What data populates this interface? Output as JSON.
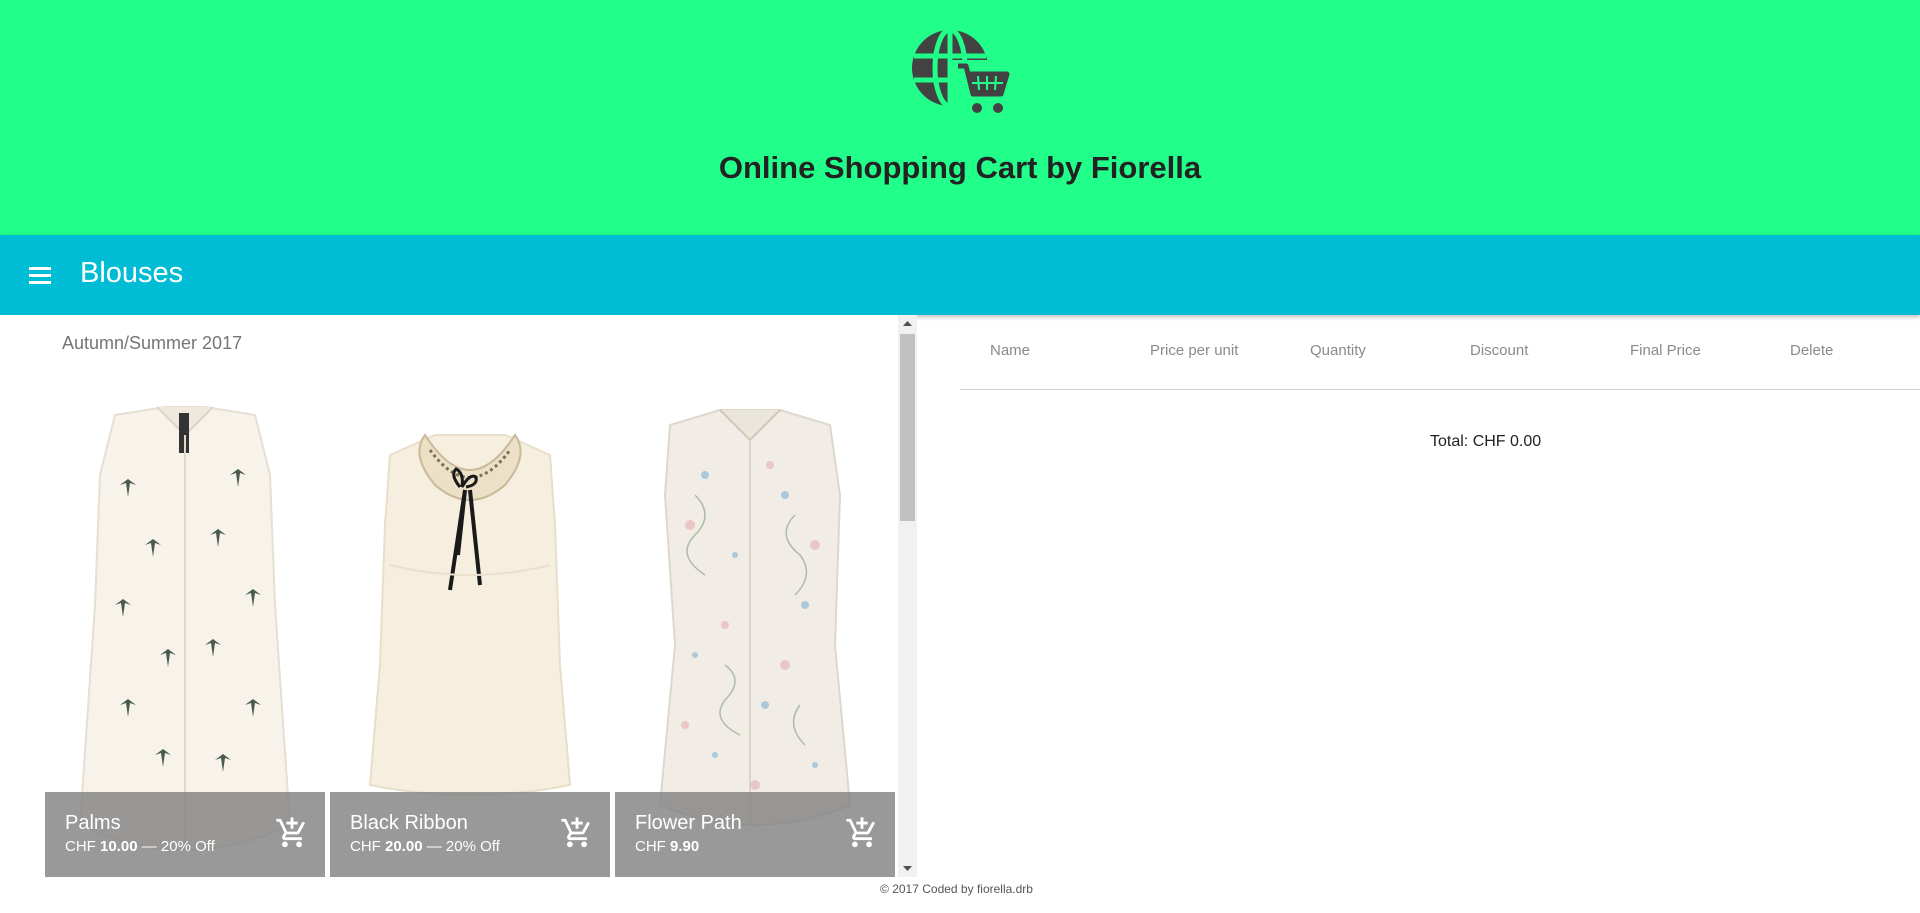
{
  "header": {
    "logo_icon": "globe-cart-icon",
    "title": "Online Shopping Cart by Fiorella",
    "background": "#21ff8a"
  },
  "toolbar": {
    "menu_icon": "hamburger-menu-icon",
    "title": "Blouses",
    "background": "#00bcd4"
  },
  "products": {
    "season": "Autumn/Summer 2017",
    "items": [
      {
        "name": "Palms",
        "currency": "CHF",
        "price": "10.00",
        "discount": "— 20% Off",
        "image": "palm-print-sleeveless-blouse"
      },
      {
        "name": "Black Ribbon",
        "currency": "CHF",
        "price": "20.00",
        "discount": "— 20% Off",
        "image": "cream-blouse-lace-collar-ribbon"
      },
      {
        "name": "Flower Path",
        "currency": "CHF",
        "price": "9.90",
        "discount": "",
        "image": "floral-print-sleeveless-blouse"
      }
    ],
    "add_to_cart_icon": "add-shopping-cart-icon"
  },
  "cart": {
    "columns": [
      "Name",
      "Price per unit",
      "Quantity",
      "Discount",
      "Final Price",
      "Delete"
    ],
    "total": "Total: CHF 0.00"
  },
  "footer": {
    "text": "© 2017 Coded by fiorella.drb"
  }
}
